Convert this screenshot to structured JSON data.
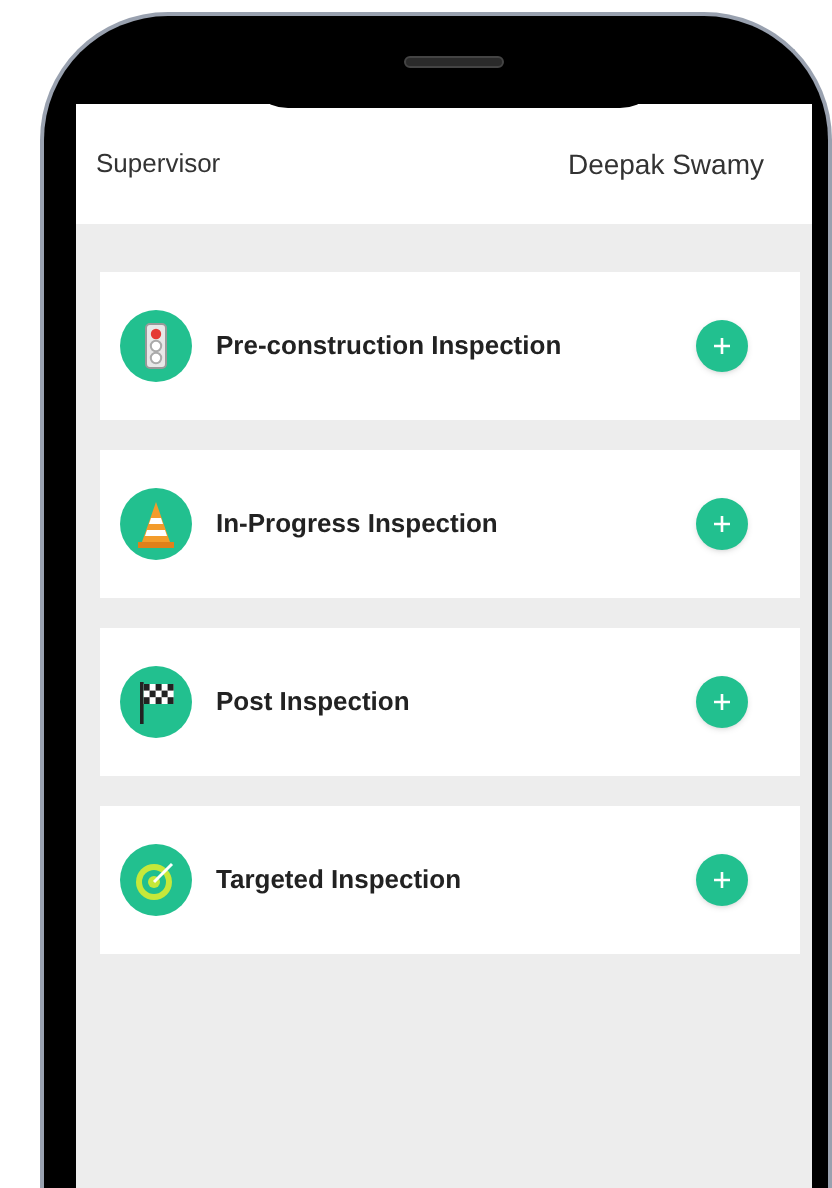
{
  "header": {
    "role": "Supervisor",
    "user": "Deepak Swamy"
  },
  "inspections": [
    {
      "title": "Pre-construction Inspection",
      "kind": "traffic-light"
    },
    {
      "title": "In-Progress Inspection",
      "kind": "cone"
    },
    {
      "title": "Post Inspection",
      "kind": "flag"
    },
    {
      "title": "Targeted Inspection",
      "kind": "target"
    }
  ]
}
